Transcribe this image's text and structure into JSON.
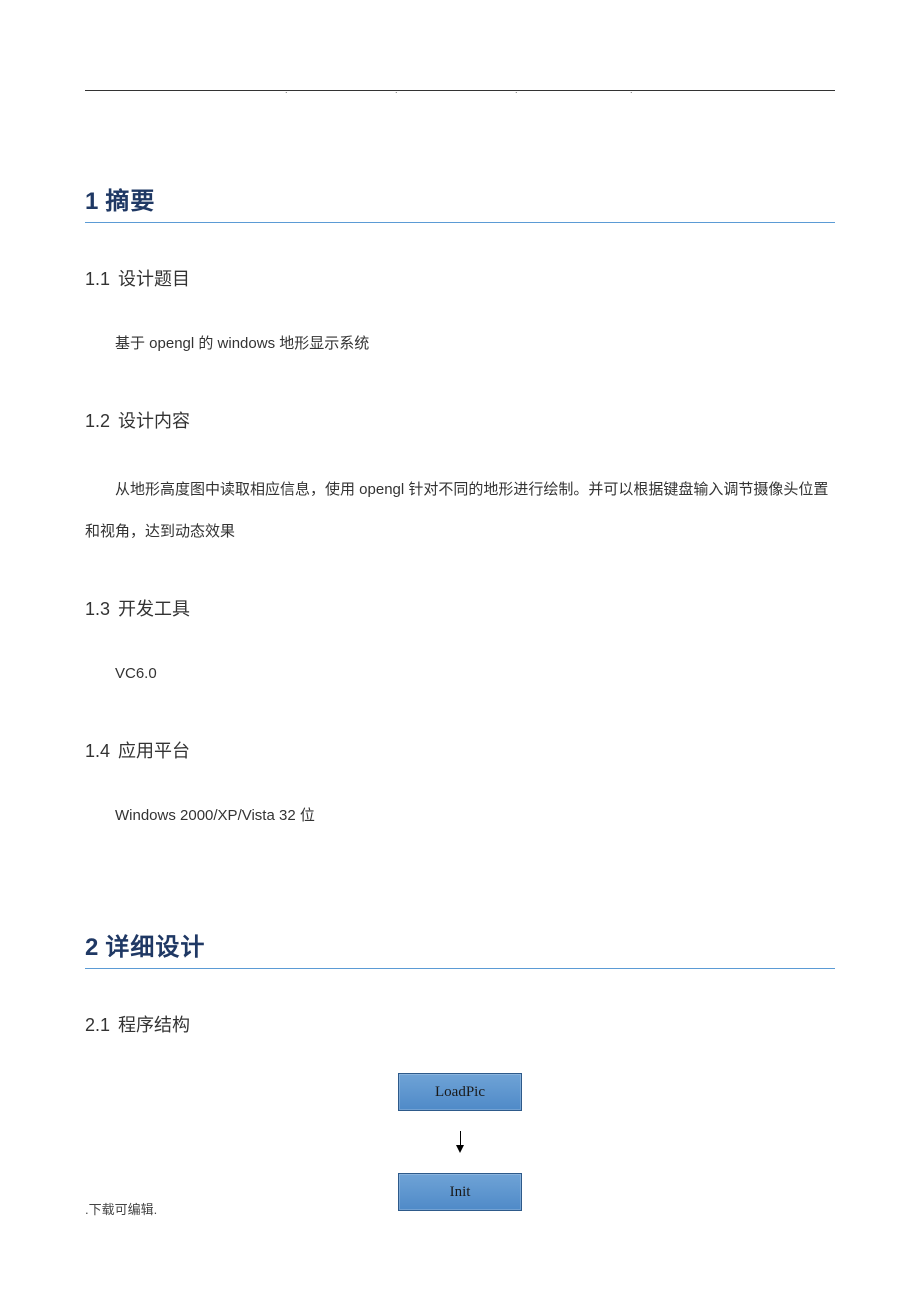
{
  "section1": {
    "num": "1",
    "title": "摘要",
    "s11": {
      "num": "1.1",
      "title": "设计题目",
      "body": "基于 opengl 的 windows 地形显示系统"
    },
    "s12": {
      "num": "1.2",
      "title": "设计内容",
      "body": "从地形高度图中读取相应信息，使用 opengl 针对不同的地形进行绘制。并可以根据键盘输入调节摄像头位置和视角，达到动态效果"
    },
    "s13": {
      "num": "1.3",
      "title": "开发工具",
      "body": "VC6.0"
    },
    "s14": {
      "num": "1.4",
      "title": "应用平台",
      "body": "Windows 2000/XP/Vista 32 位"
    }
  },
  "section2": {
    "num": "2",
    "title": "详细设计",
    "s21": {
      "num": "2.1",
      "title": "程序结构"
    }
  },
  "flow": {
    "box1": "LoadPic",
    "box2": "Init"
  },
  "footer": ".下载可编辑."
}
